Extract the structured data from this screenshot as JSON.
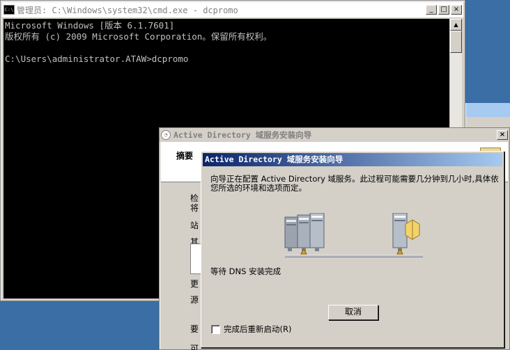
{
  "cmd": {
    "title": "管理员: C:\\Windows\\system32\\cmd.exe - dcpromo",
    "icon": "cmd-icon",
    "lines": [
      "Microsoft Windows [版本 6.1.7601]",
      "版权所有 (c) 2009 Microsoft Corporation。保留所有权利。",
      "",
      "C:\\Users\\administrator.ATAW>dcpromo"
    ]
  },
  "wizard": {
    "title": "Active Directory 域服务安装向导",
    "header_title": "摘要",
    "partial_labels": [
      "检",
      "将",
      "站",
      "其",
      "更",
      "源",
      "要",
      "可"
    ]
  },
  "progress": {
    "title": "Active Directory 域服务安装向导",
    "description": "向导正在配置 Active Directory 域服务。此过程可能需要几分钟到几小时,具体依您所选的环境和选项而定。",
    "status": "等待 DNS 安装完成",
    "cancel_label": "取消",
    "restart_label": "完成后重新启动(R)",
    "restart_checked": false
  },
  "window_buttons": {
    "minimize": "_",
    "maximize": "□",
    "close": "×"
  },
  "colors": {
    "desktop": "#3a6ea5",
    "titlebar_active_start": "#0a246a",
    "titlebar_active_end": "#a6caf0",
    "console_bg": "#000000",
    "console_fg": "#c0c0c0"
  }
}
